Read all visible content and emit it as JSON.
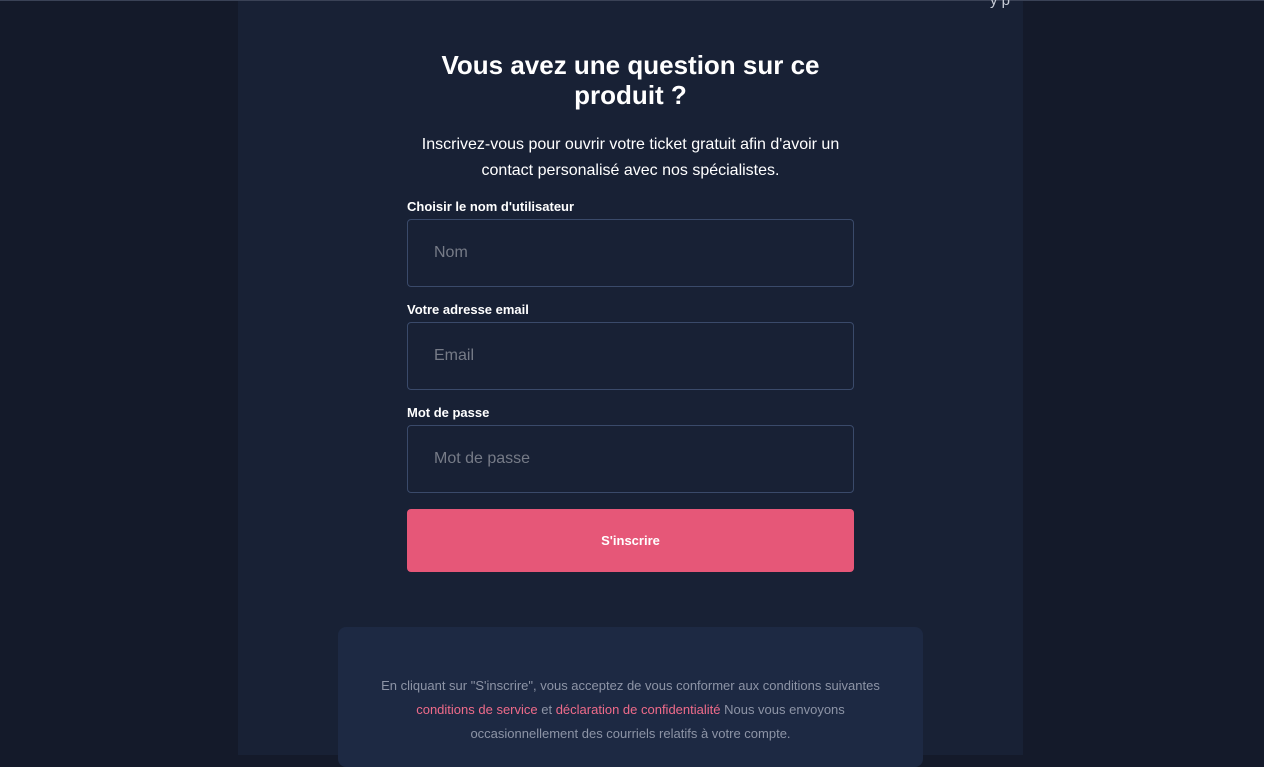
{
  "header": {
    "clipped_text": "y   p"
  },
  "form": {
    "title": "Vous avez une question sur ce produit ?",
    "subtitle": "Inscrivez-vous pour ouvrir votre ticket gratuit afin d'avoir un contact personalisé avec nos spécialistes.",
    "username_label": "Choisir le nom d'utilisateur",
    "username_placeholder": "Nom",
    "email_label": "Votre adresse email",
    "email_placeholder": "Email",
    "password_label": "Mot de passe",
    "password_placeholder": "Mot de passe",
    "submit_label": "S'inscrire"
  },
  "legal": {
    "text_before": "En cliquant sur \"S'inscrire\", vous acceptez de vous conformer aux conditions suivantes ",
    "terms_link": "conditions de service",
    "connector": " et ",
    "privacy_link": "déclaration de confidentialité",
    "text_after": " Nous vous envoyons occasionnellement des courriels relatifs à votre compte."
  },
  "colors": {
    "background": "#141a2a",
    "panel": "#182135",
    "accent": "#e65778",
    "link": "#ef6b8a"
  }
}
